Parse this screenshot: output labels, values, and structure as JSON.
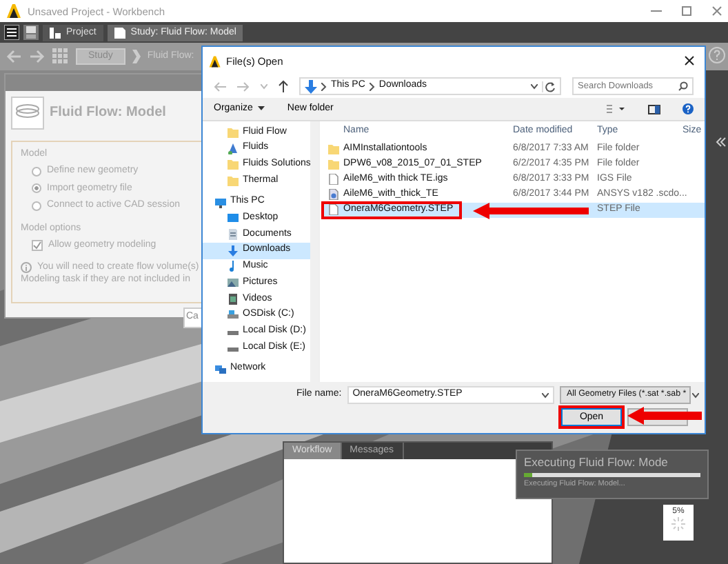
{
  "window": {
    "title": "Unsaved Project - Workbench"
  },
  "tabs": [
    {
      "label": "Project",
      "selected": false
    },
    {
      "label": "Study: Fluid Flow: Model",
      "selected": true
    }
  ],
  "breadcrumb": {
    "study_button": "Study",
    "current": "Fluid Flow:"
  },
  "panel": {
    "title": "Fluid Flow: Model",
    "model_label": "Model",
    "radios": [
      {
        "label": "Define new geometry",
        "selected": false
      },
      {
        "label": "Import geometry file",
        "selected": true
      },
      {
        "label": "Connect to active CAD session",
        "selected": false
      }
    ],
    "options_label": "Model options",
    "checkbox": {
      "label": "Allow geometry modeling",
      "checked": true
    },
    "info_lines": [
      "You will need to create flow volume(s)",
      "Modeling task if they are not included in"
    ],
    "button": "Ca"
  },
  "bottom_tabs": [
    {
      "label": "Workflow",
      "selected": true
    },
    {
      "label": "Messages",
      "selected": false
    }
  ],
  "progress_popup": {
    "title": "Executing Fluid Flow: Mode",
    "level": 0.05,
    "status": "Executing Fluid Flow: Model...",
    "percent": "5%"
  },
  "dialog": {
    "title": "File(s) Open",
    "path": [
      "This PC",
      "Downloads"
    ],
    "search_placeholder": "Search Downloads",
    "organize": "Organize",
    "new_folder": "New folder",
    "nav": [
      {
        "label": "Fluid Flow",
        "kind": "folder",
        "selected": false
      },
      {
        "label": "Fluids",
        "kind": "fluid",
        "selected": false
      },
      {
        "label": "Fluids Solutions",
        "kind": "folder",
        "selected": false
      },
      {
        "label": "Thermal",
        "kind": "folder",
        "selected": false
      },
      {
        "label": "This PC",
        "kind": "pc",
        "selected": false,
        "children": [
          {
            "label": "Desktop",
            "kind": "desktop",
            "selected": false
          },
          {
            "label": "Documents",
            "kind": "documents",
            "selected": false
          },
          {
            "label": "Downloads",
            "kind": "downloads",
            "selected": true
          },
          {
            "label": "Music",
            "kind": "music",
            "selected": false
          },
          {
            "label": "Pictures",
            "kind": "pictures",
            "selected": false
          },
          {
            "label": "Videos",
            "kind": "videos",
            "selected": false
          },
          {
            "label": "OSDisk (C:)",
            "kind": "osdisk",
            "selected": false
          },
          {
            "label": "Local Disk (D:)",
            "kind": "disk",
            "selected": false
          },
          {
            "label": "Local Disk (E:)",
            "kind": "disk",
            "selected": false
          }
        ]
      },
      {
        "label": "Network",
        "kind": "network",
        "selected": false
      }
    ],
    "columns": [
      "Name",
      "Date modified",
      "Type",
      "Size"
    ],
    "files": [
      {
        "name": "AIMInstallationtools",
        "date": "6/8/2017 7:33 AM",
        "type": "File folder",
        "kind": "folder",
        "selected": false
      },
      {
        "name": "DPW6_v08_2015_07_01_STEP",
        "date": "6/2/2017 4:35 PM",
        "type": "File folder",
        "kind": "folder",
        "selected": false
      },
      {
        "name": "AileM6_with thick TE.igs",
        "date": "6/8/2017 3:33 PM",
        "type": "IGS File",
        "kind": "file",
        "selected": false
      },
      {
        "name": "AileM6_with_thick_TE",
        "date": "6/8/2017 3:44 PM",
        "type": "ANSYS v182 .scdo...",
        "kind": "app",
        "selected": false
      },
      {
        "name": "OneraM6Geometry.STEP",
        "type": "STEP File",
        "kind": "file",
        "selected": true,
        "annotated": true
      }
    ],
    "file_name_label": "File name:",
    "file_name": "OneraM6Geometry.STEP",
    "file_type": "All Geometry Files (*.sat *.sab *",
    "open_button": "Open",
    "open_annotated": true
  }
}
